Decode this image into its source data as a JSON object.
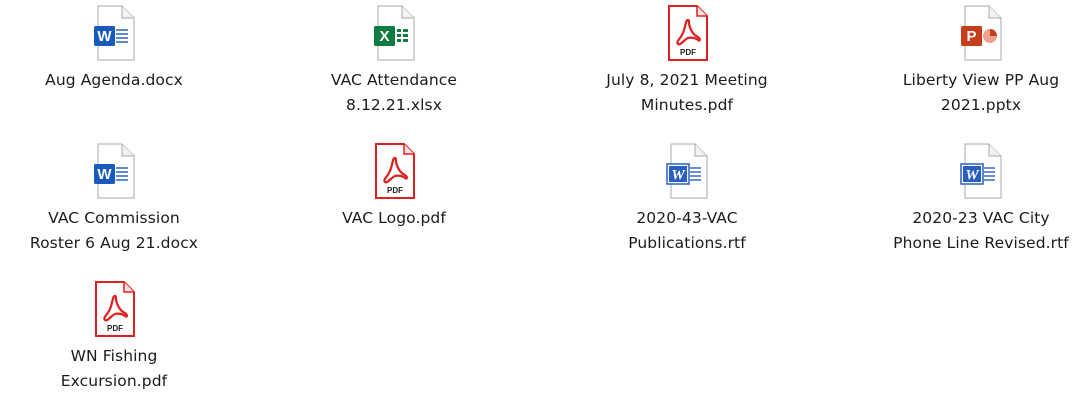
{
  "files": [
    {
      "name": "Aug Agenda.docx",
      "type": "docx"
    },
    {
      "name": "VAC Attendance\n8.12.21.xlsx",
      "type": "xlsx"
    },
    {
      "name": "July 8, 2021 Meeting\nMinutes.pdf",
      "type": "pdf"
    },
    {
      "name": "Liberty View PP Aug\n2021.pptx",
      "type": "pptx"
    },
    {
      "name": "VAC Commission\nRoster 6 Aug 21.docx",
      "type": "docx"
    },
    {
      "name": "VAC Logo.pdf",
      "type": "pdf"
    },
    {
      "name": "2020-43-VAC\nPublications.rtf",
      "type": "rtf"
    },
    {
      "name": "2020-23 VAC City\nPhone Line Revised.rtf",
      "type": "rtf"
    },
    {
      "name": "WN Fishing\nExcursion.pdf",
      "type": "pdf"
    }
  ],
  "icons": {
    "docx": {
      "name": "word-document-icon",
      "letter": "W",
      "color": "#185abd"
    },
    "xlsx": {
      "name": "excel-spreadsheet-icon",
      "letter": "X",
      "color": "#107c41"
    },
    "pdf": {
      "name": "pdf-document-icon",
      "label": "PDF",
      "color": "#e02020"
    },
    "pptx": {
      "name": "powerpoint-presentation-icon",
      "letter": "P",
      "color": "#c43e1c"
    },
    "rtf": {
      "name": "wordpad-document-icon",
      "letter": "W",
      "color": "#2a5fc2"
    }
  }
}
